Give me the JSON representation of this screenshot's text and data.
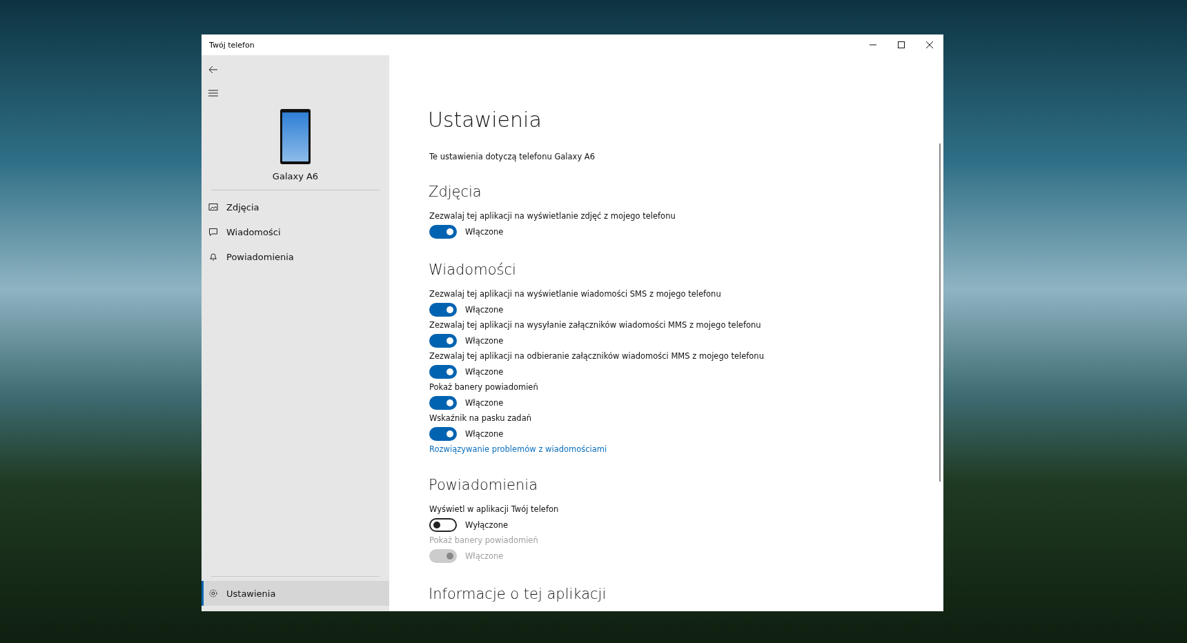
{
  "window": {
    "title": "Twój telefon"
  },
  "sidebar": {
    "device_name": "Galaxy A6",
    "items": [
      {
        "label": "Zdjęcia",
        "selected": false
      },
      {
        "label": "Wiadomości",
        "selected": false
      },
      {
        "label": "Powiadomienia",
        "selected": false
      }
    ],
    "footer_item": {
      "label": "Ustawienia",
      "selected": true
    }
  },
  "page": {
    "title": "Ustawienia",
    "subtitle": "Te ustawienia dotyczą telefonu Galaxy A6",
    "sections": [
      {
        "heading": "Zdjęcia",
        "items": [
          {
            "kind": "toggle",
            "label": "Zezwalaj tej aplikacji na wyświetlanie zdjęć z mojego telefonu",
            "state_text": "Włączone",
            "on": true,
            "disabled": false
          }
        ]
      },
      {
        "heading": "Wiadomości",
        "items": [
          {
            "kind": "toggle",
            "label": "Zezwalaj tej aplikacji na wyświetlanie wiadomości SMS z mojego telefonu",
            "state_text": "Włączone",
            "on": true,
            "disabled": false
          },
          {
            "kind": "toggle",
            "label": "Zezwalaj tej aplikacji na wysyłanie załączników wiadomości MMS z mojego telefonu",
            "state_text": "Włączone",
            "on": true,
            "disabled": false
          },
          {
            "kind": "toggle",
            "label": "Zezwalaj tej aplikacji na odbieranie załączników wiadomości MMS z mojego telefonu",
            "state_text": "Włączone",
            "on": true,
            "disabled": false
          },
          {
            "kind": "toggle",
            "label": "Pokaż banery powiadomień",
            "state_text": "Włączone",
            "on": true,
            "disabled": false
          },
          {
            "kind": "toggle",
            "label": "Wskaźnik na pasku zadań",
            "state_text": "Włączone",
            "on": true,
            "disabled": false
          },
          {
            "kind": "link",
            "label": "Rozwiązywanie problemów z wiadomościami"
          }
        ]
      },
      {
        "heading": "Powiadomienia",
        "items": [
          {
            "kind": "toggle",
            "label": "Wyświetl w aplikacji Twój telefon",
            "state_text": "Wyłączone",
            "on": false,
            "disabled": false
          },
          {
            "kind": "toggle",
            "label": "Pokaż banery powiadomień",
            "state_text": "Włączone",
            "on": true,
            "disabled": true
          }
        ]
      },
      {
        "heading": "Informacje o tej aplikacji"
      }
    ]
  }
}
